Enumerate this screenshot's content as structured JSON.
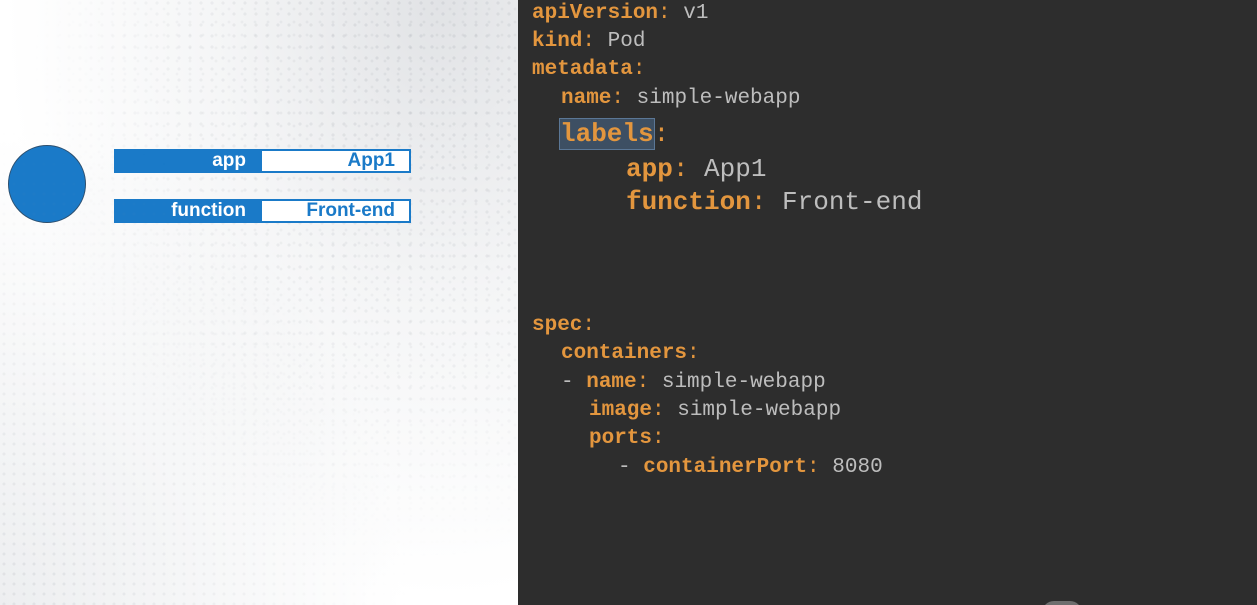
{
  "diagram": {
    "pod": {
      "color": "#1a7ac8"
    },
    "labels": [
      {
        "key": "app",
        "value": "App1"
      },
      {
        "key": "function",
        "value": "Front-end"
      }
    ]
  },
  "code": {
    "colors": {
      "key": "#e3963e",
      "value": "#bdbdbd",
      "background": "#2d2d2d"
    },
    "lines": [
      {
        "key": "apiVersion",
        "value": " v1"
      },
      {
        "key": "kind",
        "value": " Pod"
      },
      {
        "key": "metadata",
        "value": ""
      },
      {
        "key": "name",
        "value": " simple-webapp"
      },
      {
        "key": "labels",
        "value": ""
      },
      {
        "key": "app",
        "value": " App1"
      },
      {
        "key": "function",
        "value": " Front-end"
      },
      {
        "key": "spec",
        "value": ""
      },
      {
        "key": "containers",
        "value": ""
      },
      {
        "prefix": "- ",
        "key": "name",
        "value": " simple-webapp"
      },
      {
        "key": "image",
        "value": " simple-webapp"
      },
      {
        "key": "ports",
        "value": ""
      },
      {
        "prefix": "- ",
        "key": "containerPort",
        "value": " 8080"
      }
    ]
  }
}
